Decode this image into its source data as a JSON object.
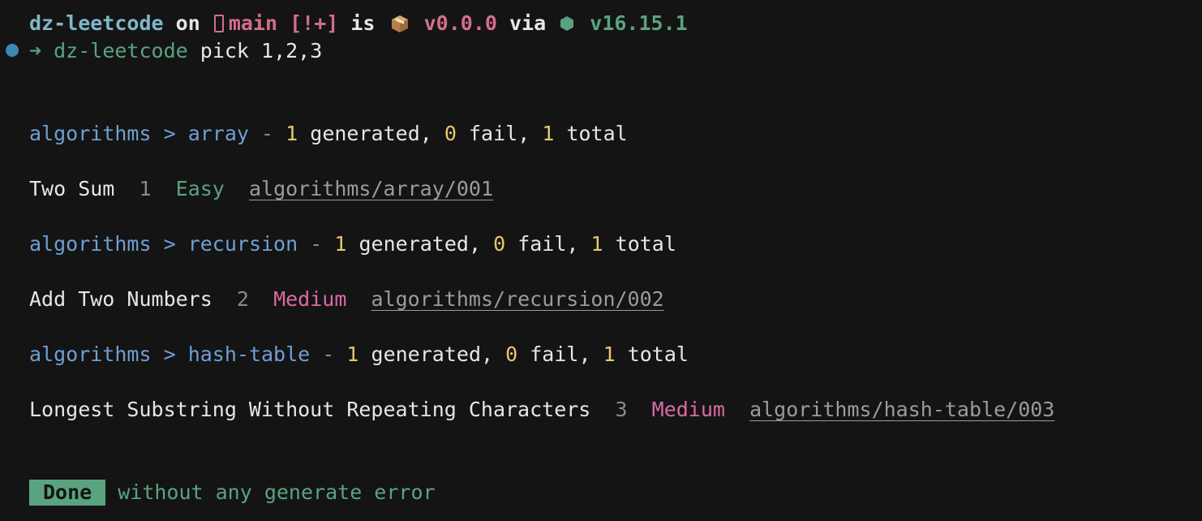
{
  "prompt": {
    "dir": "dz-leetcode",
    "on": "on",
    "branch": "main",
    "git_status": "[!+]",
    "is": "is",
    "package_version": "v0.0.0",
    "via": "via",
    "node_version": "v16.15.1",
    "icons": [
      "git-branch-icon",
      "package-icon",
      "nodejs-icon"
    ]
  },
  "command": {
    "arrow": "➜",
    "dir": "dz-leetcode",
    "text": "pick 1,2,3"
  },
  "groups": [
    {
      "category": "algorithms",
      "sep": ">",
      "tag": "array",
      "dash": "-",
      "generated": "1",
      "generated_label": "generated,",
      "fail": "0",
      "fail_label": "fail,",
      "total": "1",
      "total_label": "total",
      "problem": {
        "title": "Two Sum",
        "id": "1",
        "difficulty": "Easy",
        "path": "algorithms/array/001"
      }
    },
    {
      "category": "algorithms",
      "sep": ">",
      "tag": "recursion",
      "dash": "-",
      "generated": "1",
      "generated_label": "generated,",
      "fail": "0",
      "fail_label": "fail,",
      "total": "1",
      "total_label": "total",
      "problem": {
        "title": "Add Two Numbers",
        "id": "2",
        "difficulty": "Medium",
        "path": "algorithms/recursion/002"
      }
    },
    {
      "category": "algorithms",
      "sep": ">",
      "tag": "hash-table",
      "dash": "-",
      "generated": "1",
      "generated_label": "generated,",
      "fail": "0",
      "fail_label": "fail,",
      "total": "1",
      "total_label": "total",
      "problem": {
        "title": "Longest Substring Without Repeating Characters",
        "id": "3",
        "difficulty": "Medium",
        "path": "algorithms/hash-table/003"
      }
    }
  ],
  "footer": {
    "badge": "Done",
    "message": "without any generate error"
  },
  "colors": {
    "background": "#141414",
    "dir": "#7fb7c9",
    "branch": "#d46e8a",
    "green": "#5aa37f",
    "blue": "#6f9fd3",
    "yellow": "#e7c86b",
    "magenta": "#db6aa5",
    "prompt_dot": "#3d86b8"
  }
}
